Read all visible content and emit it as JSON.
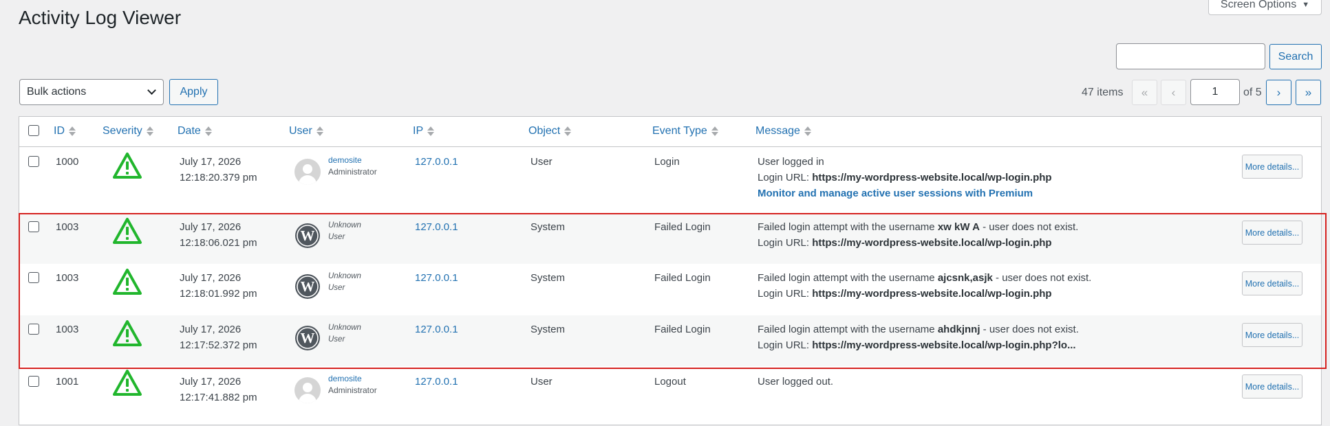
{
  "screen_options": {
    "label": "Screen Options",
    "caret": "▼"
  },
  "page_title": "Activity Log Viewer",
  "search": {
    "button": "Search",
    "value": ""
  },
  "bulk": {
    "selected": "Bulk actions",
    "apply": "Apply"
  },
  "pagination": {
    "items": "47 items",
    "first": "«",
    "prev": "‹",
    "next": "›",
    "last": "»",
    "current_page": "1",
    "of_pages": "of 5"
  },
  "columns": [
    "ID",
    "Severity",
    "Date",
    "User",
    "IP",
    "Object",
    "Event Type",
    "Message"
  ],
  "colors": {
    "accent": "#2271b1",
    "severity_icon": "#21b62d",
    "highlight_border": "#d5201e"
  },
  "rows": [
    {
      "id": "1000",
      "severity_icon": "warning-triangle-icon",
      "date": "July 17, 2026",
      "time": "12:18:20.379 pm",
      "user_name": "demosite",
      "user_role": "Administrator",
      "avatar": "default-avatar",
      "ip": "127.0.0.1",
      "object": "User",
      "event": "Login",
      "msg_line1": "User logged in",
      "msg_url_prefix": "Login URL: ",
      "msg_url": "https://my-wordpress-website.local/wp-login.php",
      "promo": "Monitor and manage active user sessions with Premium",
      "more": "More details..."
    },
    {
      "id": "1003",
      "severity_icon": "warning-triangle-icon",
      "date": "July 17, 2026",
      "time": "12:18:06.021 pm",
      "user_name": "Unknown",
      "user_role": "User",
      "avatar": "wordpress-logo",
      "ip": "127.0.0.1",
      "object": "System",
      "event": "Failed Login",
      "msg_prefix": "Failed login attempt with the username ",
      "msg_username": "xw kW A",
      "msg_suffix": " - user does not exist.",
      "msg_url_prefix": "Login URL: ",
      "msg_url": "https://my-wordpress-website.local/wp-login.php",
      "more": "More details..."
    },
    {
      "id": "1003",
      "severity_icon": "warning-triangle-icon",
      "date": "July 17, 2026",
      "time": "12:18:01.992 pm",
      "user_name": "Unknown",
      "user_role": "User",
      "avatar": "wordpress-logo",
      "ip": "127.0.0.1",
      "object": "System",
      "event": "Failed Login",
      "msg_prefix": "Failed login attempt with the username ",
      "msg_username": "ajcsnk,asjk",
      "msg_suffix": " - user does not exist.",
      "msg_url_prefix": "Login URL: ",
      "msg_url": "https://my-wordpress-website.local/wp-login.php",
      "more": "More details..."
    },
    {
      "id": "1003",
      "severity_icon": "warning-triangle-icon",
      "date": "July 17, 2026",
      "time": "12:17:52.372 pm",
      "user_name": "Unknown",
      "user_role": "User",
      "avatar": "wordpress-logo",
      "ip": "127.0.0.1",
      "object": "System",
      "event": "Failed Login",
      "msg_prefix": "Failed login attempt with the username ",
      "msg_username": "ahdkjnnj",
      "msg_suffix": " - user does not exist.",
      "msg_url_prefix": "Login URL: ",
      "msg_url": "https://my-wordpress-website.local/wp-login.php?lo...",
      "more": "More details..."
    },
    {
      "id": "1001",
      "severity_icon": "warning-triangle-icon",
      "date": "July 17, 2026",
      "time": "12:17:41.882 pm",
      "user_name": "demosite",
      "user_role": "Administrator",
      "avatar": "default-avatar",
      "ip": "127.0.0.1",
      "object": "User",
      "event": "Logout",
      "msg_line1": "User logged out.",
      "more": "More details..."
    }
  ]
}
